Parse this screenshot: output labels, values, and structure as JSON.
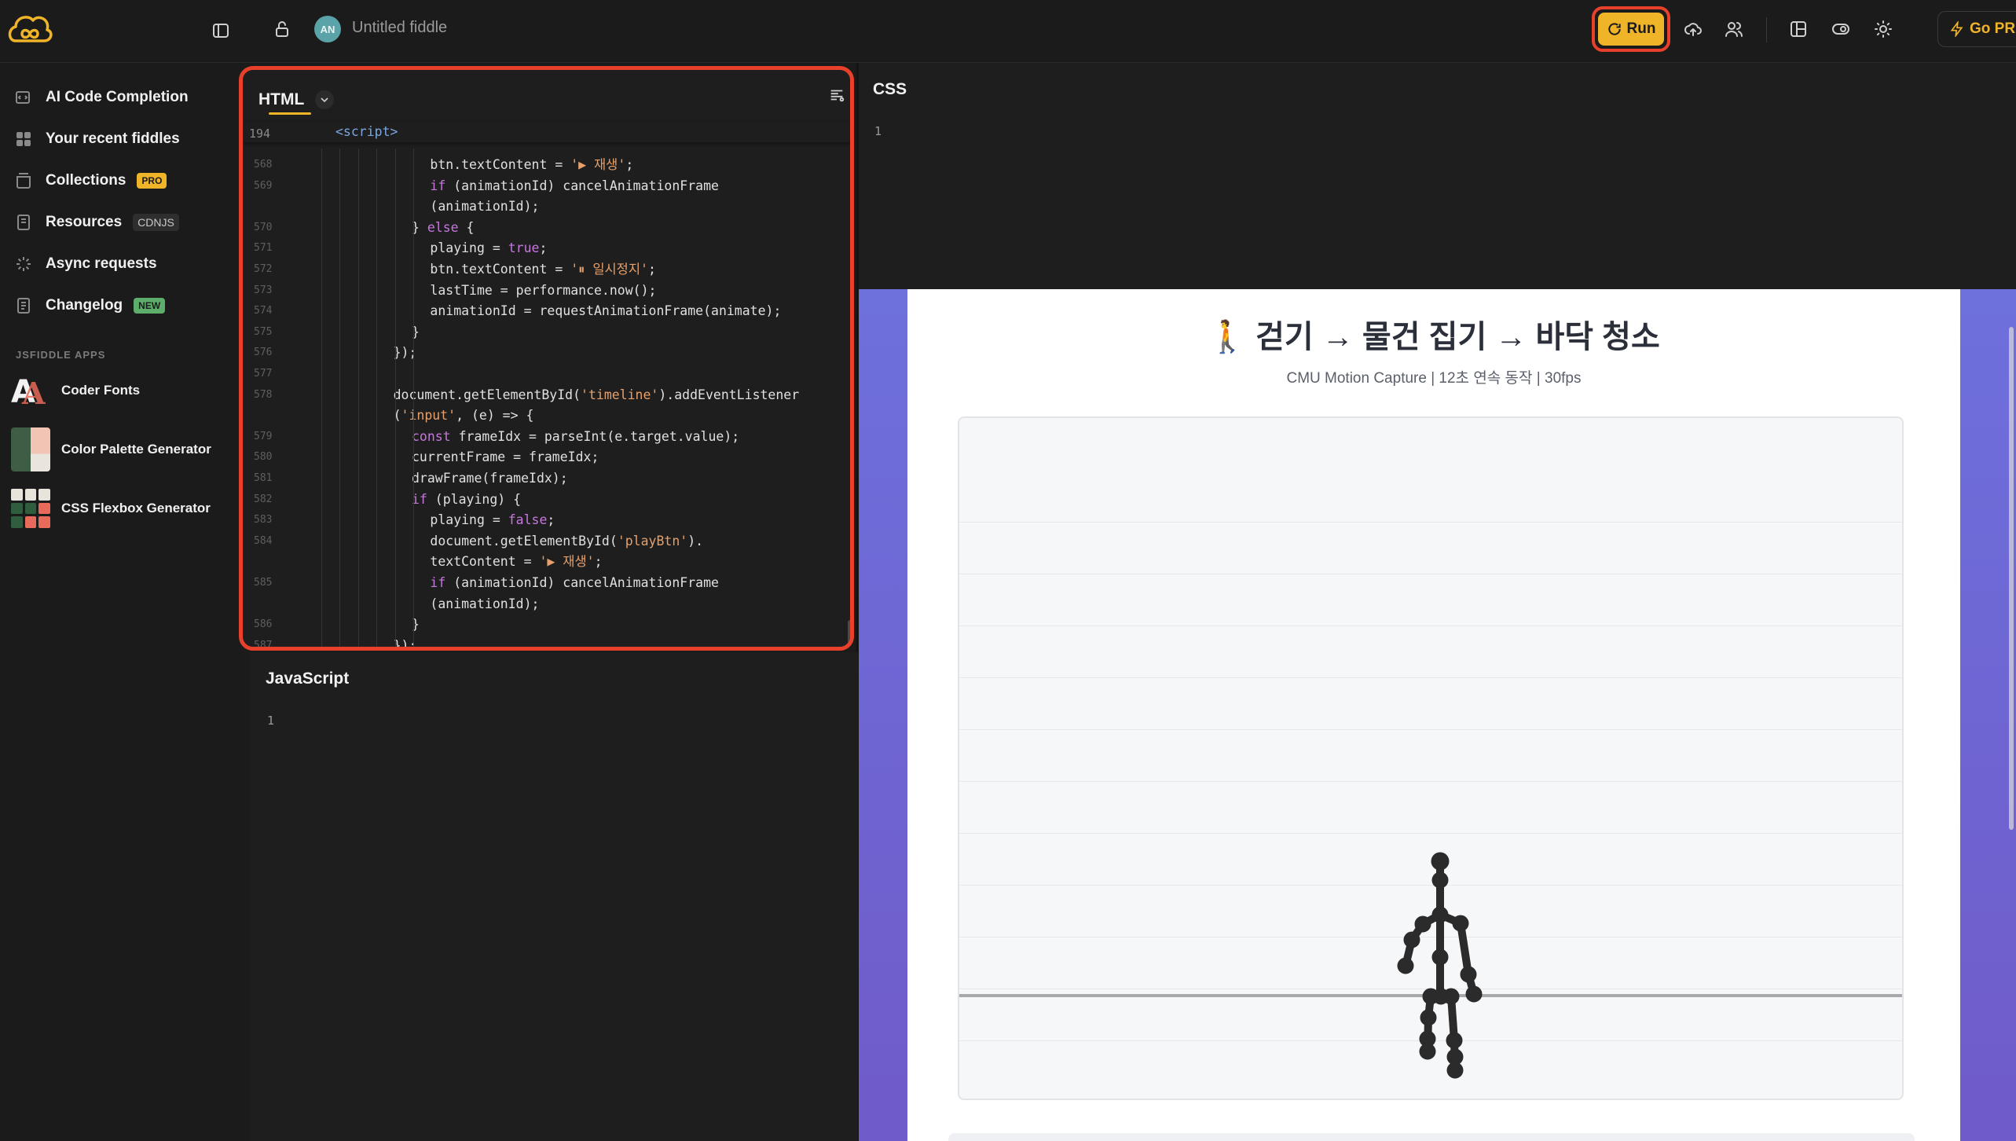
{
  "topbar": {
    "avatar_initials": "AN",
    "fiddle_title": "Untitled fiddle",
    "run_label": "Run",
    "go_pro_label": "Go PR"
  },
  "sidebar": {
    "items": [
      {
        "label": "AI Code Completion",
        "icon": "ai-code-icon"
      },
      {
        "label": "Your recent fiddles",
        "icon": "grid-icon"
      },
      {
        "label": "Collections",
        "icon": "collection-icon",
        "badge": "PRO"
      },
      {
        "label": "Resources",
        "icon": "resources-icon",
        "badge": "CDNJS"
      },
      {
        "label": "Async requests",
        "icon": "loader-icon"
      },
      {
        "label": "Changelog",
        "icon": "changelog-icon",
        "badge": "NEW"
      }
    ],
    "apps_heading": "JSFIDDLE APPS",
    "apps": [
      {
        "label": "Coder Fonts"
      },
      {
        "label": "Color Palette Generator"
      },
      {
        "label": "CSS Flexbox Generator"
      }
    ]
  },
  "html_panel": {
    "title": "HTML",
    "sticky_line_no": "194",
    "sticky_code": "<script>",
    "lines": [
      {
        "n": "568",
        "indent": 6,
        "code": "btn.textContent = '▶ 재생';"
      },
      {
        "n": "569",
        "indent": 6,
        "code": "if (animationId) cancelAnimationFrame"
      },
      {
        "n": "",
        "indent": 6,
        "code": "(animationId);"
      },
      {
        "n": "570",
        "indent": 5,
        "code": "} else {"
      },
      {
        "n": "571",
        "indent": 6,
        "code": "playing = true;"
      },
      {
        "n": "572",
        "indent": 6,
        "code": "btn.textContent = '⏸ 일시정지';"
      },
      {
        "n": "573",
        "indent": 6,
        "code": "lastTime = performance.now();"
      },
      {
        "n": "574",
        "indent": 6,
        "code": "animationId = requestAnimationFrame(animate);"
      },
      {
        "n": "575",
        "indent": 5,
        "code": "}"
      },
      {
        "n": "576",
        "indent": 4,
        "code": "});"
      },
      {
        "n": "577",
        "indent": 4,
        "code": ""
      },
      {
        "n": "578",
        "indent": 4,
        "code": "document.getElementById('timeline').addEventListener"
      },
      {
        "n": "",
        "indent": 4,
        "code": "('input', (e) => {"
      },
      {
        "n": "579",
        "indent": 5,
        "code": "const frameIdx = parseInt(e.target.value);"
      },
      {
        "n": "580",
        "indent": 5,
        "code": "currentFrame = frameIdx;"
      },
      {
        "n": "581",
        "indent": 5,
        "code": "drawFrame(frameIdx);"
      },
      {
        "n": "582",
        "indent": 5,
        "code": "if (playing) {"
      },
      {
        "n": "583",
        "indent": 6,
        "code": "playing = false;"
      },
      {
        "n": "584",
        "indent": 6,
        "code": "document.getElementById('playBtn')."
      },
      {
        "n": "",
        "indent": 6,
        "code": "textContent = '▶ 재생';"
      },
      {
        "n": "585",
        "indent": 6,
        "code": "if (animationId) cancelAnimationFrame"
      },
      {
        "n": "",
        "indent": 6,
        "code": "(animationId);"
      },
      {
        "n": "586",
        "indent": 5,
        "code": "}"
      },
      {
        "n": "587",
        "indent": 4,
        "code": "});"
      }
    ]
  },
  "js_panel": {
    "title": "JavaScript",
    "line_no": "1"
  },
  "css_panel": {
    "title": "CSS",
    "line_no": "1"
  },
  "preview": {
    "heading": "🚶 걷기 → 물건 집기 → 바닥 청소",
    "subtitle": "CMU Motion Capture | 12초 연속 동작 | 30fps"
  }
}
